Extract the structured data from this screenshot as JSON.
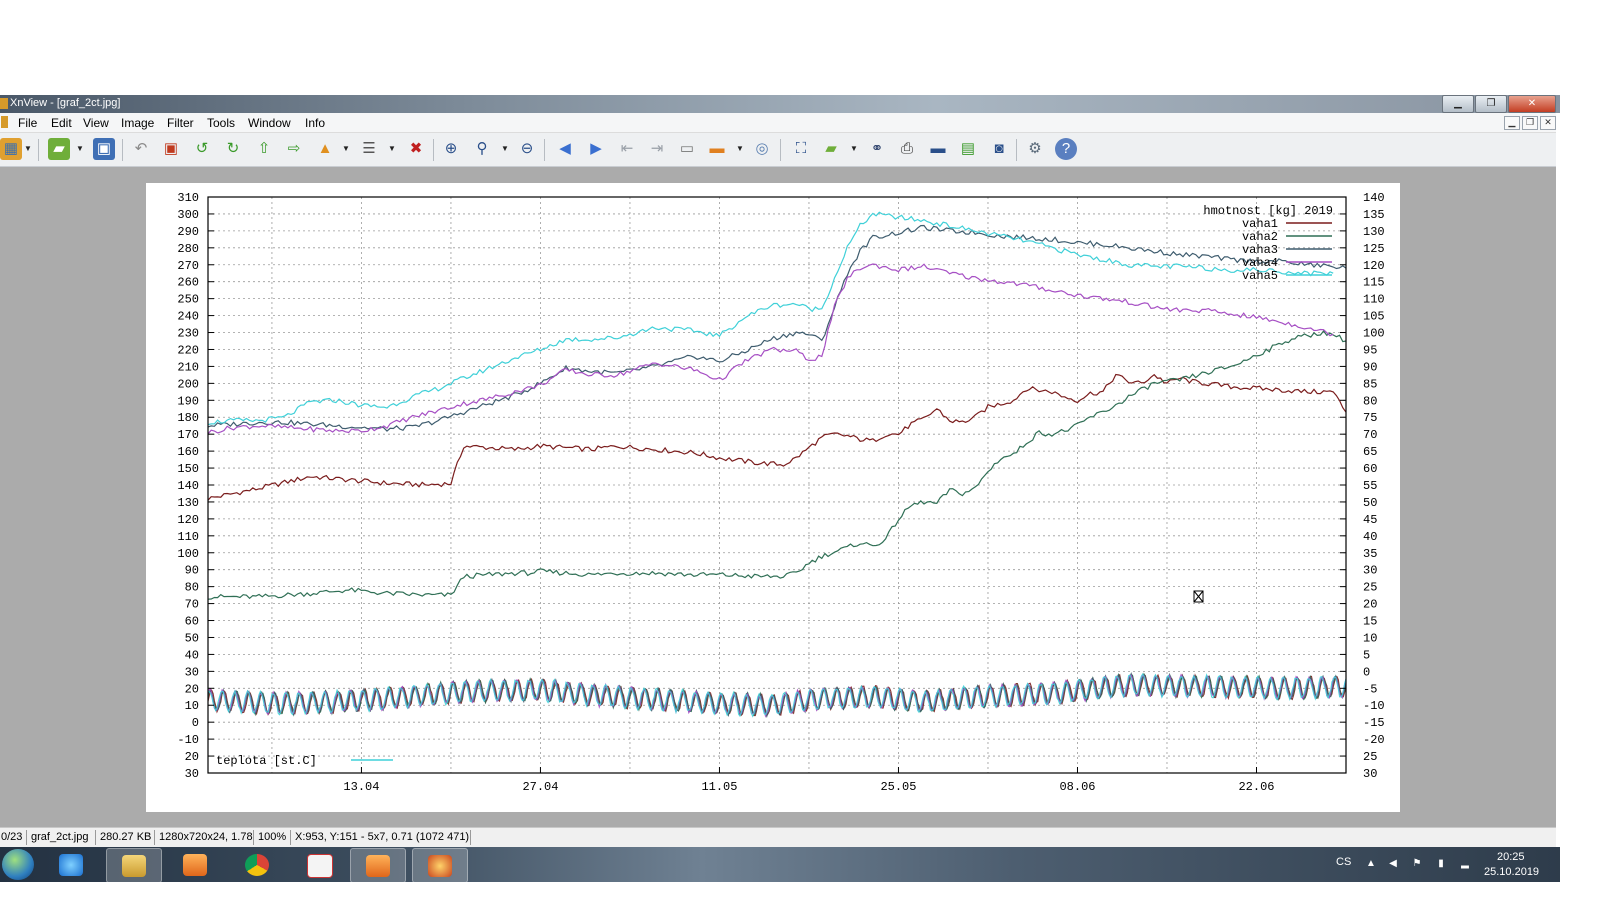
{
  "window": {
    "title": "XnView - [graf_2ct.jpg]",
    "minimize_glyph": "▁",
    "maximize_glyph": "❐",
    "close_glyph": "✕"
  },
  "menu": [
    "File",
    "Edit",
    "View",
    "Image",
    "Filter",
    "Tools",
    "Window",
    "Info"
  ],
  "toolbar_icons": [
    "browser-icon",
    "open-folder-icon",
    "save-icon",
    "undo-icon",
    "crop-icon",
    "rotate-left-icon",
    "rotate-right-icon",
    "arrow-up-icon",
    "arrow-right-icon",
    "open-export-icon",
    "properties-icon",
    "delete-icon",
    "zoom-in-icon",
    "zoom-icon",
    "zoom-out-icon",
    "previous-icon",
    "next-icon",
    "first-icon",
    "last-icon",
    "slideshow-icon",
    "screen-icon",
    "capture-icon",
    "fullscreen-icon",
    "convert-icon",
    "find-icon",
    "print-icon",
    "scanner-icon",
    "acquire-icon",
    "camera-icon",
    "settings-icon",
    "help-icon"
  ],
  "status": {
    "index": "0/23",
    "filename": "graf_2ct.jpg",
    "filesize": "280.27 KB",
    "dimensions": "1280x720x24, 1.78",
    "zoom": "100%",
    "cursor": "X:953, Y:151 - 5x7, 0.71 (1072 471)"
  },
  "taskbar": {
    "language": "CS",
    "time": "20:25",
    "date": "25.10.2019",
    "apps": [
      "internet-explorer-icon",
      "file-explorer-icon",
      "media-player-icon",
      "chrome-icon",
      "graph-icon",
      "media-player-2-icon",
      "xnview-icon"
    ]
  },
  "colors": {
    "vaha1": "#7a1c1c",
    "vaha2": "#2f6f55",
    "vaha3": "#3e5c6e",
    "vaha4": "#a64fc4",
    "vaha5": "#3fd0d8",
    "teplota": "#3fd0d8"
  },
  "chart_data": {
    "type": "line",
    "legend_title": "hmotnost [kg] 2019",
    "temp_legend": "teplota [st.C]",
    "x_tick_labels": [
      "13.04",
      "27.04",
      "11.05",
      "25.05",
      "08.06",
      "22.06"
    ],
    "x_range_days": [
      0,
      89
    ],
    "x_tick_days": [
      12,
      26,
      40,
      54,
      68,
      82
    ],
    "y_left_ticks": [
      310,
      300,
      290,
      280,
      270,
      260,
      250,
      240,
      230,
      220,
      210,
      200,
      190,
      180,
      170,
      160,
      150,
      140,
      130,
      120,
      110,
      100,
      90,
      80,
      70,
      60,
      50,
      40,
      30,
      20,
      10,
      0,
      -10,
      -20,
      -30
    ],
    "y_left_labels": [
      "310",
      "300",
      "290",
      "280",
      "270",
      "260",
      "250",
      "240",
      "230",
      "220",
      "210",
      "200",
      "190",
      "180",
      "170",
      "160",
      "150",
      "140",
      "130",
      "120",
      "110",
      "100",
      "90",
      "80",
      "70",
      "60",
      "50",
      "40",
      "30",
      "20",
      "10",
      "0",
      "-10",
      "20",
      "30"
    ],
    "y_right_labels": [
      "140",
      "135",
      "130",
      "125",
      "120",
      "115",
      "110",
      "105",
      "100",
      "95",
      "90",
      "85",
      "80",
      "75",
      "70",
      "65",
      "60",
      "55",
      "50",
      "45",
      "40",
      "35",
      "30",
      "25",
      "20",
      "15",
      "10",
      "5",
      "0",
      "-5",
      "-10",
      "-15",
      "-20",
      "25",
      "30"
    ],
    "series": [
      {
        "name": "vaha1",
        "x": [
          0,
          4,
          8,
          11,
          14,
          17,
          19,
          20,
          22,
          24,
          25,
          26,
          28,
          30,
          32,
          35,
          38,
          40,
          43,
          45,
          46,
          48,
          49,
          50,
          51,
          52,
          53,
          54,
          55,
          56,
          57,
          58,
          59,
          60,
          61,
          62,
          63,
          64,
          65,
          66,
          67,
          68,
          69,
          70,
          71,
          72,
          73,
          74,
          75,
          76,
          77,
          78,
          79,
          80,
          82,
          84,
          86,
          88,
          89
        ],
        "y": [
          132,
          138,
          145,
          143,
          141,
          140,
          141,
          163,
          162,
          161,
          162,
          163,
          162,
          161,
          163,
          161,
          159,
          156,
          153,
          152,
          156,
          168,
          170,
          169,
          167,
          166,
          170,
          170,
          176,
          179,
          185,
          178,
          177,
          180,
          186,
          188,
          190,
          197,
          196,
          195,
          192,
          190,
          194,
          195,
          205,
          201,
          200,
          205,
          200,
          203,
          201,
          200,
          199,
          198,
          197,
          196,
          195,
          195,
          183
        ]
      },
      {
        "name": "vaha2",
        "x": [
          0,
          4,
          8,
          11,
          14,
          17,
          19,
          20,
          22,
          24,
          25,
          26,
          28,
          30,
          32,
          35,
          38,
          40,
          43,
          45,
          46,
          47,
          48,
          50,
          51,
          52,
          53,
          54,
          55,
          56,
          57,
          58,
          59,
          60,
          61,
          62,
          63,
          64,
          65,
          66,
          67,
          68,
          69,
          70,
          71,
          72,
          73,
          74,
          75,
          76,
          77,
          78,
          79,
          80,
          81,
          82,
          83,
          84,
          85,
          86,
          87,
          88,
          89
        ],
        "y": [
          74,
          74,
          76,
          78,
          76,
          75,
          75,
          86,
          87,
          88,
          88,
          89,
          88,
          87,
          88,
          88,
          87,
          87,
          86,
          86,
          88,
          94,
          98,
          103,
          106,
          104,
          108,
          120,
          128,
          130,
          129,
          137,
          135,
          138,
          148,
          156,
          158,
          165,
          171,
          170,
          172,
          175,
          180,
          183,
          187,
          192,
          196,
          200,
          201,
          202,
          204,
          206,
          208,
          210,
          213,
          217,
          220,
          224,
          227,
          228,
          230,
          229,
          225
        ]
      },
      {
        "name": "vaha3",
        "x": [
          0,
          2,
          4,
          6,
          8,
          10,
          12,
          14,
          16,
          18,
          20,
          22,
          24,
          26,
          28,
          30,
          32,
          35,
          38,
          40,
          42,
          44,
          46,
          47,
          48,
          49,
          50,
          51,
          52,
          54,
          56,
          58,
          60,
          62,
          64,
          66,
          68,
          70,
          72,
          74,
          76,
          78,
          80,
          82,
          84,
          86,
          88,
          89
        ],
        "y": [
          175,
          176,
          177,
          177,
          176,
          175,
          174,
          173,
          174,
          178,
          183,
          188,
          193,
          200,
          209,
          207,
          206,
          210,
          216,
          213,
          219,
          226,
          230,
          229,
          225,
          245,
          265,
          278,
          286,
          289,
          292,
          290,
          289,
          287,
          286,
          285,
          283,
          282,
          280,
          278,
          276,
          275,
          273,
          272,
          272,
          270,
          269,
          268
        ]
      },
      {
        "name": "vaha4",
        "x": [
          0,
          2,
          4,
          6,
          8,
          10,
          12,
          14,
          16,
          18,
          20,
          22,
          24,
          26,
          28,
          30,
          32,
          35,
          38,
          40,
          42,
          44,
          46,
          47,
          48,
          49,
          50,
          51,
          52,
          54,
          56,
          58,
          60,
          62,
          64,
          66,
          68,
          70,
          72,
          74,
          76,
          78,
          80,
          82,
          84,
          86,
          88
        ],
        "y": [
          171,
          174,
          175,
          174,
          173,
          172,
          172,
          175,
          180,
          184,
          188,
          191,
          195,
          199,
          208,
          205,
          205,
          212,
          208,
          202,
          213,
          220,
          219,
          214,
          216,
          245,
          262,
          268,
          270,
          267,
          269,
          265,
          262,
          260,
          258,
          255,
          252,
          250,
          248,
          245,
          243,
          243,
          241,
          239,
          236,
          233,
          229
        ]
      },
      {
        "name": "vaha5",
        "x": [
          0,
          2,
          4,
          6,
          8,
          10,
          12,
          14,
          16,
          18,
          20,
          22,
          24,
          26,
          28,
          30,
          32,
          35,
          38,
          40,
          42,
          44,
          46,
          47,
          48,
          49,
          50,
          51,
          52,
          54,
          56,
          58,
          60,
          62,
          64,
          66,
          68,
          70,
          72,
          74,
          76,
          78,
          80,
          82,
          84,
          86,
          88
        ],
        "y": [
          177,
          178,
          178,
          180,
          189,
          190,
          187,
          186,
          192,
          197,
          203,
          209,
          215,
          220,
          226,
          226,
          227,
          233,
          231,
          228,
          239,
          246,
          247,
          244,
          244,
          262,
          280,
          293,
          300,
          298,
          296,
          293,
          290,
          287,
          284,
          280,
          276,
          273,
          270,
          269,
          269,
          268,
          267,
          267,
          266,
          265,
          265
        ]
      }
    ],
    "temperature": {
      "period_days": 1,
      "base": [
        [
          0,
          13
        ],
        [
          5,
          11
        ],
        [
          10,
          12
        ],
        [
          14,
          14
        ],
        [
          20,
          18
        ],
        [
          26,
          19
        ],
        [
          30,
          16
        ],
        [
          36,
          13
        ],
        [
          40,
          11
        ],
        [
          44,
          10
        ],
        [
          48,
          14
        ],
        [
          52,
          15
        ],
        [
          56,
          12
        ],
        [
          60,
          15
        ],
        [
          66,
          17
        ],
        [
          72,
          22
        ],
        [
          78,
          21
        ],
        [
          84,
          20
        ],
        [
          89,
          21
        ]
      ],
      "amplitude": 6,
      "lines": [
        "vaha1",
        "vaha2",
        "vaha3",
        "vaha4",
        "vaha5"
      ]
    }
  }
}
